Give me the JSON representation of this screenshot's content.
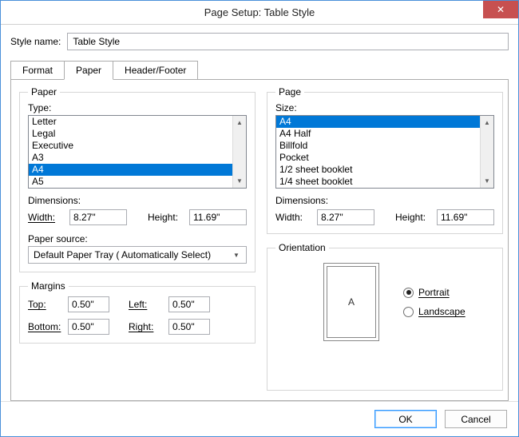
{
  "window": {
    "title": "Page Setup: Table Style"
  },
  "style": {
    "label": "Style name:",
    "value": "Table Style"
  },
  "tabs": {
    "format": "Format",
    "paper": "Paper",
    "headerfooter": "Header/Footer"
  },
  "paper": {
    "legend": "Paper",
    "type_label": "Type:",
    "types": [
      "Letter",
      "Legal",
      "Executive",
      "A3",
      "A4",
      "A5"
    ],
    "selected_type": "A4",
    "dimensions_label": "Dimensions:",
    "width_label": "Width:",
    "width_value": "8.27\"",
    "height_label": "Height:",
    "height_value": "11.69\"",
    "source_label": "Paper source:",
    "source_value": "Default Paper Tray ( Automatically Select)"
  },
  "margins": {
    "legend": "Margins",
    "top_label": "Top:",
    "top_value": "0.50\"",
    "left_label": "Left:",
    "left_value": "0.50\"",
    "bottom_label": "Bottom:",
    "bottom_value": "0.50\"",
    "right_label": "Right:",
    "right_value": "0.50\""
  },
  "page": {
    "legend": "Page",
    "size_label": "Size:",
    "sizes": [
      "A4",
      "A4 Half",
      "Billfold",
      "Pocket",
      "1/2 sheet booklet",
      "1/4 sheet booklet"
    ],
    "selected_size": "A4",
    "dimensions_label": "Dimensions:",
    "width_label": "Width:",
    "width_value": "8.27\"",
    "height_label": "Height:",
    "height_value": "11.69\""
  },
  "orientation": {
    "legend": "Orientation",
    "preview_letter": "A",
    "portrait": "Portrait",
    "landscape": "Landscape",
    "selected": "Portrait"
  },
  "buttons": {
    "ok": "OK",
    "cancel": "Cancel"
  }
}
